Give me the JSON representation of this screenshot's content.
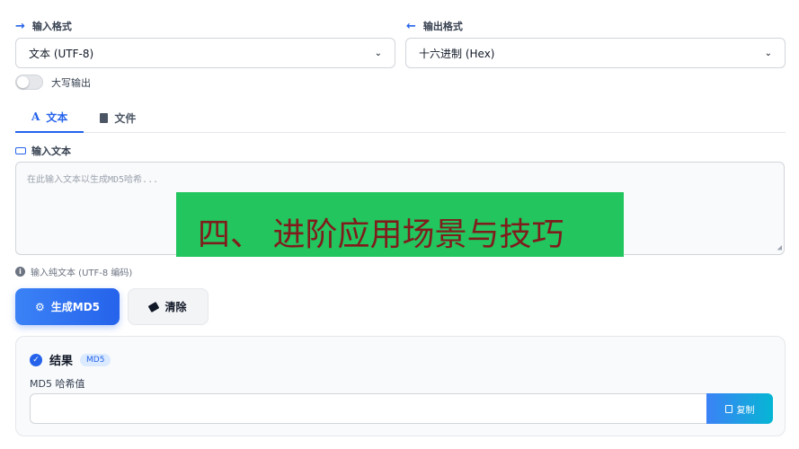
{
  "input_format": {
    "label": "输入格式",
    "selected": "文本 (UTF-8)"
  },
  "output_format": {
    "label": "输出格式",
    "selected": "十六进制 (Hex)"
  },
  "uppercase_toggle": {
    "label": "大写输出",
    "on": false
  },
  "tabs": [
    {
      "label": "文本",
      "active": true
    },
    {
      "label": "文件",
      "active": false
    }
  ],
  "text_input": {
    "label": "输入文本",
    "placeholder": "在此输入文本以生成MD5哈希...",
    "hint": "输入纯文本 (UTF-8 编码)"
  },
  "overlay_banner": "四、 进阶应用场景与技巧",
  "buttons": {
    "generate": "生成MD5",
    "clear": "清除"
  },
  "result": {
    "title": "结果",
    "badge": "MD5",
    "label": "MD5 哈希值",
    "value": "",
    "copy_label": "复制"
  },
  "colors": {
    "accent": "#2563eb",
    "banner_bg": "#22c55e",
    "banner_text": "#7f1d1d"
  }
}
